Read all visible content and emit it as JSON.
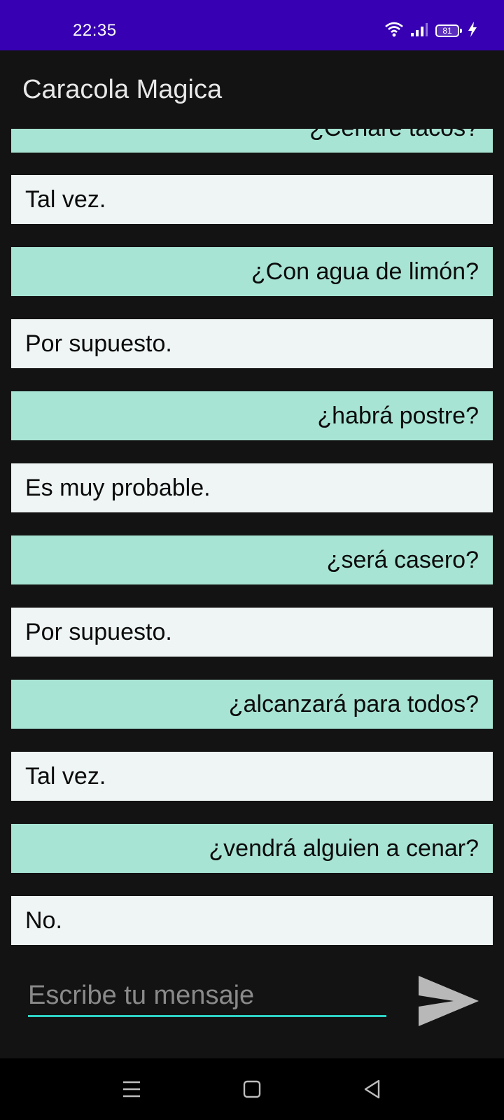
{
  "status_bar": {
    "time": "22:35",
    "battery_level": "81",
    "icons": [
      "wifi-icon",
      "signal-icon",
      "battery-icon",
      "charging-icon"
    ]
  },
  "app_bar": {
    "title": "Caracola Magica"
  },
  "messages": [
    {
      "type": "question",
      "text": "¿Cenaré tacos?"
    },
    {
      "type": "answer",
      "text": "Tal vez."
    },
    {
      "type": "question",
      "text": "¿Con agua de limón?"
    },
    {
      "type": "answer",
      "text": "Por supuesto."
    },
    {
      "type": "question",
      "text": "¿habrá postre?"
    },
    {
      "type": "answer",
      "text": "Es muy probable."
    },
    {
      "type": "question",
      "text": "¿será casero?"
    },
    {
      "type": "answer",
      "text": "Por supuesto."
    },
    {
      "type": "question",
      "text": "¿alcanzará para todos?"
    },
    {
      "type": "answer",
      "text": "Tal vez."
    },
    {
      "type": "question",
      "text": "¿vendrá alguien a cenar?"
    },
    {
      "type": "answer",
      "text": "No."
    }
  ],
  "composer": {
    "placeholder": "Escribe tu mensaje",
    "value": ""
  },
  "nav_bar": {
    "icons": [
      "menu-icon",
      "home-icon",
      "back-icon"
    ]
  },
  "colors": {
    "status_bar": "#3700b3",
    "background": "#131313",
    "question_bubble": "#a8e4d4",
    "answer_bubble": "#eef5f4",
    "input_underline": "#2ed1c3",
    "send_icon": "#b8b8b8"
  }
}
